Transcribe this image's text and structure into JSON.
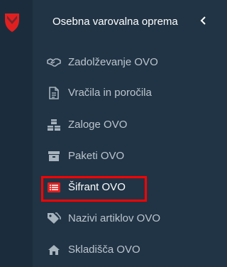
{
  "sidebar": {
    "section_title": "Osebna varovalna oprema",
    "brand_color": "#e02020",
    "highlight_color": "#ff0000",
    "items": [
      {
        "label": "Zadolževanje OVO",
        "icon": "handshake-icon"
      },
      {
        "label": "Vračila in poročila",
        "icon": "document-icon"
      },
      {
        "label": "Zaloge OVO",
        "icon": "cubes-icon"
      },
      {
        "label": "Paketi OVO",
        "icon": "archive-box-icon"
      },
      {
        "label": "Šifrant OVO",
        "icon": "list-alt-icon",
        "active": true
      },
      {
        "label": "Nazivi artiklov OVO",
        "icon": "tags-icon"
      },
      {
        "label": "Skladišča OVO",
        "icon": "home-icon"
      }
    ]
  }
}
